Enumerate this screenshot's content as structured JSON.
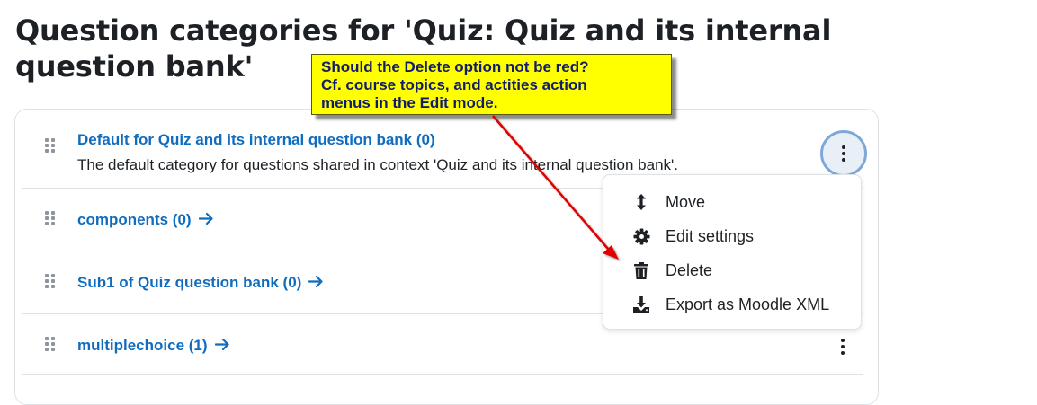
{
  "page": {
    "title": "Question categories for 'Quiz: Quiz and its internal question bank'"
  },
  "categories": [
    {
      "label": "Default for Quiz and its internal question bank (0)",
      "description": "The default category for questions shared in context 'Quiz and its internal question bank'."
    },
    {
      "label": "components (0)",
      "has_arrow": true
    },
    {
      "label": "Sub1 of Quiz question bank (0)",
      "has_arrow": true
    },
    {
      "label": "multiplechoice (1)",
      "has_arrow": true
    }
  ],
  "action_menu": {
    "items": [
      {
        "label": "Move",
        "icon": "move-vertical-icon"
      },
      {
        "label": "Edit settings",
        "icon": "gear-icon"
      },
      {
        "label": "Delete",
        "icon": "trash-icon"
      },
      {
        "label": "Export as Moodle XML",
        "icon": "download-icon"
      }
    ]
  },
  "annotation": {
    "lines": [
      "Should the Delete option not be red?",
      "Cf. course topics, and actities action",
      "menus in the Edit mode."
    ],
    "background": "#ffff00",
    "text_color": "#111c6b",
    "arrow_color": "#e00000"
  },
  "colors": {
    "link": "#0f6cbf",
    "text": "#1d2125",
    "border": "#dee2e6"
  }
}
